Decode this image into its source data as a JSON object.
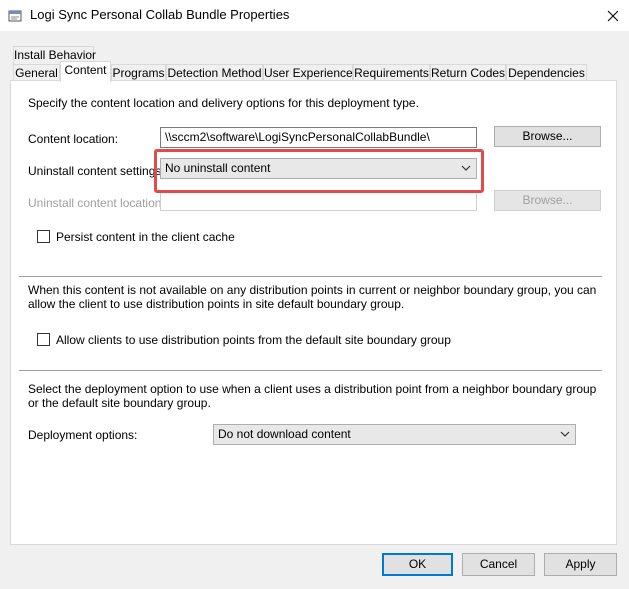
{
  "window": {
    "title": "Logi Sync Personal Collab Bundle Properties"
  },
  "tabs": {
    "row1": [
      {
        "label": "Install Behavior",
        "active": false
      }
    ],
    "row2": [
      {
        "label": "General",
        "active": false
      },
      {
        "label": "Content",
        "active": true
      },
      {
        "label": "Programs",
        "active": false
      },
      {
        "label": "Detection Method",
        "active": false
      },
      {
        "label": "User Experience",
        "active": false
      },
      {
        "label": "Requirements",
        "active": false
      },
      {
        "label": "Return Codes",
        "active": false
      },
      {
        "label": "Dependencies",
        "active": false
      }
    ]
  },
  "content": {
    "intro": "Specify the content location and delivery options for this deployment type.",
    "location_label": "Content location:",
    "location_value": "\\\\sccm2\\software\\LogiSyncPersonalCollabBundle\\",
    "browse_label": "Browse...",
    "uninstall_settings_label": "Uninstall content settings:",
    "uninstall_settings_value": "No uninstall content",
    "uninstall_location_label": "Uninstall content location:",
    "uninstall_location_value": "",
    "uninstall_browse_label": "Browse...",
    "persist_label": "Persist content in the client cache",
    "persist_checked": false,
    "distribution_text": "When this content is not available on any distribution points in current or neighbor boundary group, you can allow the client to use distribution points in site default boundary group.",
    "allow_default_label": "Allow clients to use distribution points from the default site boundary group",
    "allow_default_checked": false,
    "deployment_text": "Select the deployment option to use when a client uses a distribution point from a neighbor boundary group or the default site boundary group.",
    "deployment_options_label": "Deployment options:",
    "deployment_options_value": "Do not download content"
  },
  "buttons": {
    "ok": "OK",
    "cancel": "Cancel",
    "apply": "Apply"
  },
  "colors": {
    "highlight": "#e04b4b",
    "default_button_border": "#0078d7"
  },
  "icons": {
    "app": "properties-window-icon",
    "close": "close-icon",
    "dropdown": "chevron-down-icon",
    "checkbox": "checkbox-icon"
  }
}
